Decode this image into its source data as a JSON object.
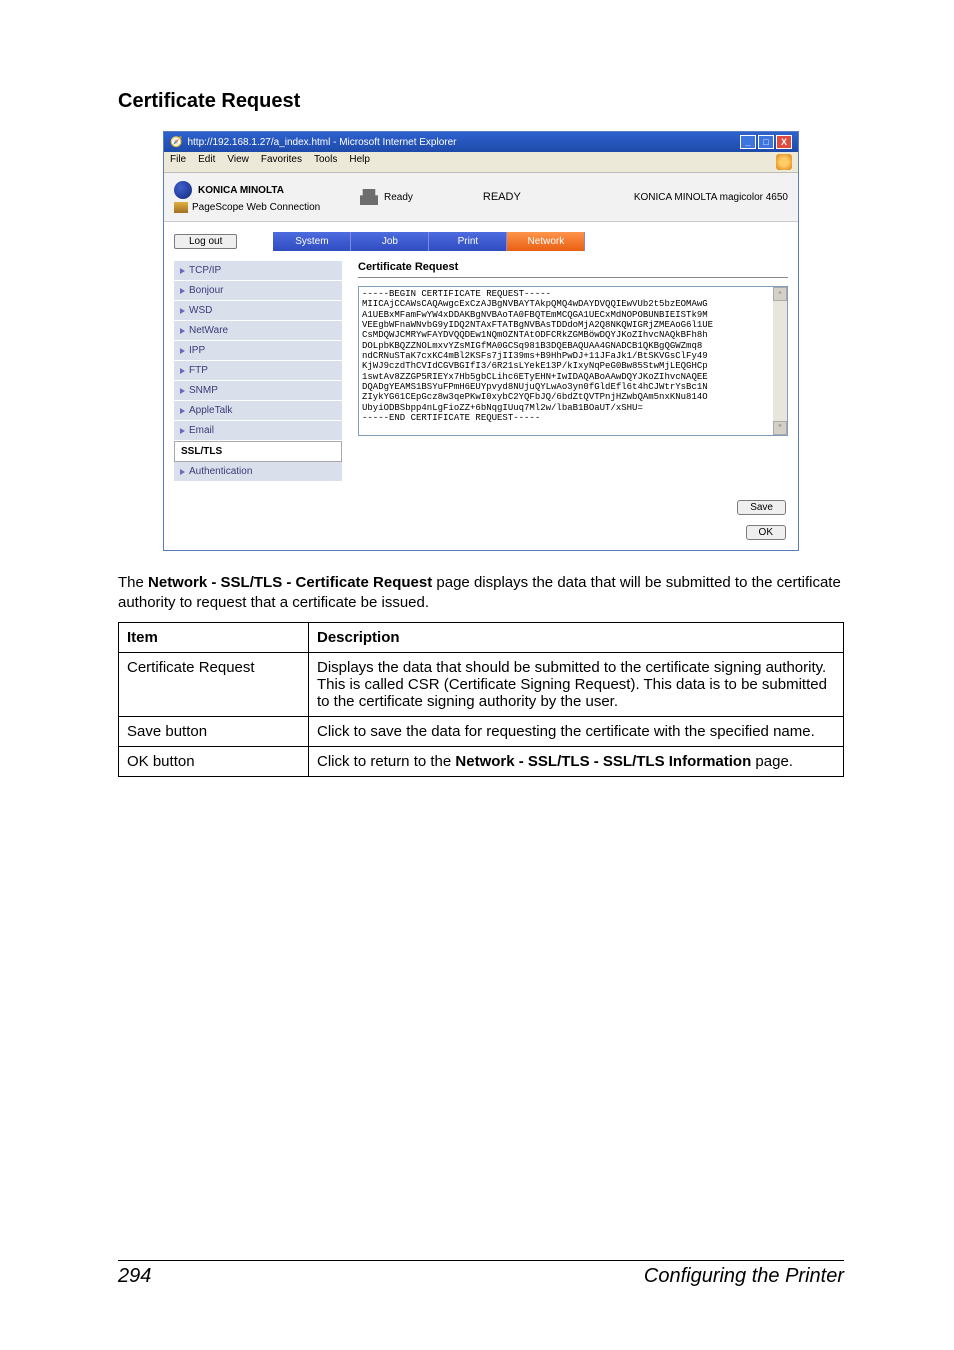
{
  "section": {
    "title": "Certificate Request"
  },
  "browser": {
    "title": "http://192.168.1.27/a_index.html - Microsoft Internet Explorer",
    "menus": {
      "file": "File",
      "edit": "Edit",
      "view": "View",
      "favorites": "Favorites",
      "tools": "Tools",
      "help": "Help"
    }
  },
  "header": {
    "brand": "KONICA MINOLTA",
    "subbrand": "PageScope Web Connection",
    "readySmall": "Ready",
    "readyBig": "READY",
    "model": "KONICA MINOLTA magicolor 4650"
  },
  "actionbar": {
    "logout": "Log out",
    "tabs": {
      "system": "System",
      "job": "Job",
      "print": "Print",
      "network": "Network"
    }
  },
  "sidenav": {
    "items": [
      {
        "label": "TCP/IP"
      },
      {
        "label": "Bonjour"
      },
      {
        "label": "WSD"
      },
      {
        "label": "NetWare"
      },
      {
        "label": "IPP"
      },
      {
        "label": "FTP"
      },
      {
        "label": "SNMP"
      },
      {
        "label": "AppleTalk"
      },
      {
        "label": "Email"
      },
      {
        "label": "SSL/TLS"
      },
      {
        "label": "Authentication"
      }
    ]
  },
  "pane": {
    "title": "Certificate Request",
    "pem": "-----BEGIN CERTIFICATE REQUEST-----\nMIICAjCCAWsCAQAwgcExCzAJBgNVBAYTAkpQMQ4wDAYDVQQIEwVUb2t5bzEOMAwG\nA1UEBxMFamFwYW4xDDAKBgNVBAoTA0FBQTEmMCQGA1UECxMdNOPOBUNBIEISTk9M\nVEEgbWFnaWNvbG9yIDQ2NTAxFTATBgNVBAsTDDdoMjA2Q8NKQWIGRjZMEAoG6l1UE\nCsMDQWJCMRYwFAYDVQQDEw1NQmOZNTAtODFCRkZGMBöwDQYJKoZIhvcNAQkBFh8h\nDOLpbKBQZZNOLmxvYZsMIGfMA0GCSq981B3DQEBAQUAA4GNADCB1QKBgQGWZmq8\nndCRNuSTaK7cxKC4mBl2KSFs7jII39ms+B9HhPwDJ+11JFaJk1/BtSKVGsClFy49\nKjWJ9czdThCVIdCGVBGIfI3/6R21sLYekE13P/kIxyNqPeG0Bw85StwMjLEQGHCp\n1swtAv8ZZGP5RIEYx7Hb5gbCLihc6ETyEHN+IwIDAQABoAAwDQYJKoZIhvcNAQEE\nDQADgYEAMS1BSYuFPmH6EUYpvyd8NUjuQYLwAo3yn0fGldEfl6t4hCJWtrYsBc1N\nZIykYG61CEpGcz8w3qePKwI0xybC2YQFbJQ/6bdZtQVTPnjHZwbQAm5nxKNu814O\nUbyiODBSbpp4nLgFioZZ+6bNqgIUuq7Ml2w/lbaB1BOaUT/xSHU=\n-----END CERTIFICATE REQUEST-----"
  },
  "buttons": {
    "save": "Save",
    "ok": "OK"
  },
  "body": {
    "para_pre": "The ",
    "para_bold": "Network - SSL/TLS - Certificate Request",
    "para_post": " page displays the data that will be submitted to the certificate authority to request that a certificate be issued."
  },
  "table": {
    "headers": {
      "item": "Item",
      "desc": "Description"
    },
    "rows": [
      {
        "item": "Certificate Request",
        "desc": "Displays the data that should be submitted to the certificate signing authority. This is called CSR (Certificate Signing Request). This data is to be submitted to the certificate signing authority by the user."
      },
      {
        "item": "Save button",
        "desc": "Click to save the data for requesting the certificate with the specified name."
      },
      {
        "item": "OK button",
        "desc_pre": "Click to return to the ",
        "desc_bold1": "Network - SSL/TLS - SSL/TLS Information",
        "desc_post": " page."
      }
    ]
  },
  "footer": {
    "page": "294",
    "title": "Configuring the Printer"
  }
}
